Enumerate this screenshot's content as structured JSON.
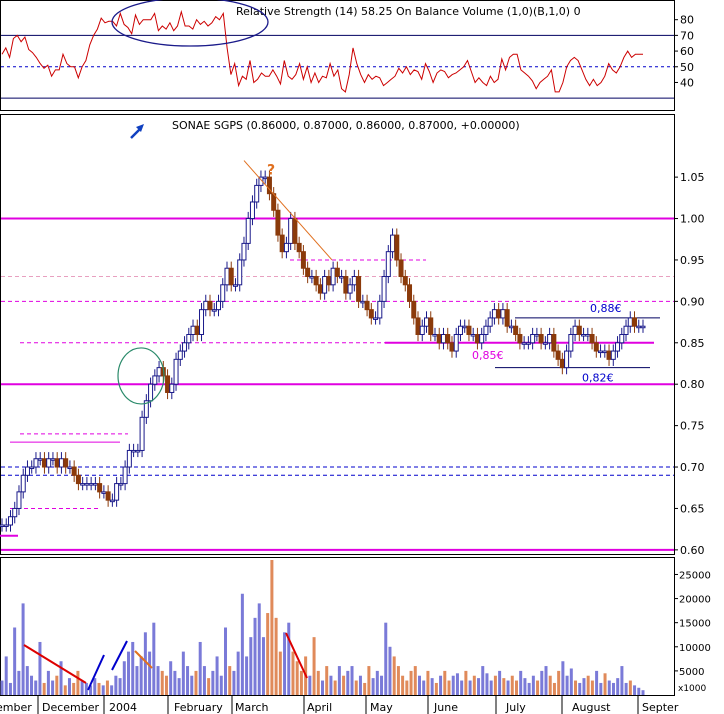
{
  "colors": {
    "rsi": "#cc0000",
    "bull": "#1a1a8a",
    "bear": "#8b3a0a",
    "vol_up": "#7a7ad8",
    "vol_down": "#e08a5a",
    "magenta": "#e000e0",
    "blue": "#0000cc",
    "green": "#2a8a6a",
    "orange": "#e07020",
    "arrow": "#1040c0",
    "frame": "#000060",
    "pink_dashed": "#e8a0c0"
  },
  "chart_data": [
    {
      "type": "line",
      "panel": "rsi",
      "title": "Relative Strength (14) 58.25  On Balance Volume (1,0)(B,1,0) 0",
      "ylim": [
        25,
        90
      ],
      "yticks": [
        40,
        50,
        60,
        70,
        80
      ],
      "reference_lines": [
        30,
        50,
        70
      ],
      "series": [
        {
          "values": [
            58,
            62,
            56,
            68,
            70,
            66,
            69,
            61,
            59,
            56,
            52,
            49,
            51,
            44,
            48,
            48,
            58,
            52,
            50,
            50,
            43,
            50,
            54,
            64,
            70,
            74,
            81,
            78,
            79,
            79,
            76,
            84,
            77,
            75,
            71,
            83,
            77,
            80,
            80,
            80,
            84,
            73,
            76,
            74,
            78,
            73,
            76,
            85,
            76,
            76,
            74,
            80,
            77,
            79,
            76,
            78,
            82,
            80,
            84,
            62,
            45,
            52,
            38,
            44,
            42,
            54,
            40,
            42,
            46,
            44,
            44,
            48,
            44,
            39,
            54,
            44,
            42,
            45,
            52,
            42,
            50,
            40,
            46,
            40,
            44,
            43,
            52,
            44,
            48,
            36,
            34,
            45,
            62,
            52,
            45,
            40,
            45,
            42,
            44,
            43,
            38,
            40,
            42,
            44,
            49,
            46,
            50,
            45,
            48,
            47,
            42,
            52,
            47,
            40,
            46,
            48,
            47,
            43,
            45,
            46,
            48,
            50,
            54,
            47,
            40,
            43,
            40,
            38,
            44,
            40,
            42,
            55,
            48,
            56,
            58,
            58,
            48,
            46,
            44,
            41,
            36,
            40,
            42,
            44,
            48,
            34,
            34,
            40,
            50,
            54,
            56,
            54,
            48,
            42,
            38,
            42,
            38,
            40,
            44,
            52,
            48,
            46,
            50,
            56,
            60,
            56,
            58,
            58,
            58
          ]
        }
      ]
    },
    {
      "type": "candlestick",
      "panel": "price",
      "title": "SONAE SGPS (0.86000, 0.87000, 0.86000, 0.87000, +0.00000)",
      "ylim": [
        0.595,
        1.125
      ],
      "yticks": [
        "0.60",
        "0.65",
        "0.70",
        "0.75",
        "0.80",
        "0.85",
        "0.90",
        "0.95",
        "1.00",
        "1.05"
      ],
      "closes": [
        0.63,
        0.63,
        0.64,
        0.65,
        0.67,
        0.69,
        0.7,
        0.7,
        0.71,
        0.71,
        0.7,
        0.71,
        0.71,
        0.7,
        0.71,
        0.7,
        0.7,
        0.69,
        0.68,
        0.68,
        0.68,
        0.68,
        0.68,
        0.67,
        0.67,
        0.66,
        0.66,
        0.68,
        0.68,
        0.7,
        0.72,
        0.72,
        0.72,
        0.76,
        0.78,
        0.8,
        0.81,
        0.82,
        0.81,
        0.79,
        0.8,
        0.83,
        0.84,
        0.85,
        0.86,
        0.87,
        0.86,
        0.89,
        0.9,
        0.89,
        0.89,
        0.9,
        0.92,
        0.94,
        0.92,
        0.92,
        0.95,
        0.97,
        1.0,
        1.02,
        1.04,
        1.05,
        1.05,
        1.03,
        1.01,
        0.98,
        0.96,
        0.97,
        1.0,
        0.97,
        0.96,
        0.94,
        0.93,
        0.93,
        0.92,
        0.91,
        0.93,
        0.92,
        0.94,
        0.93,
        0.93,
        0.91,
        0.92,
        0.93,
        0.9,
        0.9,
        0.89,
        0.88,
        0.88,
        0.9,
        0.93,
        0.96,
        0.98,
        0.95,
        0.93,
        0.92,
        0.9,
        0.88,
        0.86,
        0.87,
        0.88,
        0.86,
        0.86,
        0.85,
        0.86,
        0.85,
        0.84,
        0.86,
        0.87,
        0.87,
        0.86,
        0.86,
        0.85,
        0.86,
        0.87,
        0.88,
        0.89,
        0.88,
        0.89,
        0.87,
        0.87,
        0.86,
        0.85,
        0.85,
        0.85,
        0.86,
        0.86,
        0.85,
        0.85,
        0.86,
        0.84,
        0.83,
        0.82,
        0.84,
        0.86,
        0.87,
        0.86,
        0.86,
        0.86,
        0.85,
        0.84,
        0.84,
        0.84,
        0.83,
        0.84,
        0.85,
        0.86,
        0.87,
        0.88,
        0.87,
        0.87,
        0.87
      ],
      "reference_lines": [
        {
          "value": 1.0,
          "style": "solid",
          "color": "magenta"
        },
        {
          "value": 0.8,
          "style": "solid",
          "color": "magenta"
        },
        {
          "value": 0.6,
          "style": "solid",
          "color": "magenta"
        },
        {
          "value": 0.9,
          "style": "dashed",
          "color": "magenta"
        },
        {
          "value": 0.93,
          "style": "dashed",
          "color": "pink_dashed"
        },
        {
          "value": 0.7,
          "style": "dashed",
          "color": "blue"
        },
        {
          "value": 0.69,
          "style": "dashed",
          "color": "blue"
        }
      ],
      "annotations": [
        {
          "text": "0,88€",
          "price": 0.88,
          "color": "blue"
        },
        {
          "text": "0,85€",
          "price": 0.85,
          "color": "magenta"
        },
        {
          "text": "0,82€",
          "price": 0.82,
          "color": "blue"
        },
        {
          "text": "?",
          "color": "orange"
        }
      ]
    },
    {
      "type": "bar",
      "panel": "volume",
      "ylim": [
        0,
        28000
      ],
      "yticks": [
        5000,
        10000,
        15000,
        20000,
        25000
      ],
      "unit_label": "x1000",
      "values": [
        3000,
        8000,
        2500,
        14000,
        5000,
        19000,
        6000,
        4000,
        3000,
        11000,
        2500,
        5000,
        3000,
        4000,
        7000,
        2000,
        3500,
        2500,
        5000,
        3000,
        2500,
        2000,
        3500,
        2500,
        2000,
        3000,
        2000,
        4000,
        3500,
        7000,
        9000,
        11000,
        6000,
        8000,
        13000,
        9000,
        15000,
        6000,
        5000,
        4000,
        7000,
        5000,
        3500,
        9000,
        6000,
        4000,
        5000,
        11000,
        6000,
        3500,
        5000,
        8000,
        4000,
        14000,
        6000,
        5000,
        9000,
        21000,
        8000,
        12000,
        16000,
        19000,
        12000,
        17000,
        28000,
        16000,
        9000,
        13000,
        15000,
        9000,
        7000,
        5000,
        8000,
        4000,
        12000,
        5000,
        3000,
        6000,
        4000,
        3000,
        6000,
        4000,
        5000,
        6000,
        3000,
        4000,
        2500,
        6000,
        3500,
        5000,
        4000,
        15000,
        10000,
        8000,
        6000,
        4000,
        3000,
        5000,
        6000,
        4000,
        3000,
        5000,
        3500,
        2500,
        4000,
        5000,
        3000,
        4000,
        4500,
        3000,
        5000,
        3000,
        4000,
        3500,
        6000,
        4500,
        3000,
        4000,
        5000,
        3500,
        3000,
        4000,
        3000,
        5000,
        3500,
        2500,
        4000,
        3000,
        5000,
        6000,
        4000,
        2500,
        5000,
        7000,
        4000,
        5500,
        3000,
        2500,
        3500,
        4000,
        3000,
        5000,
        2500,
        4500,
        3000,
        2500,
        3500,
        6000,
        2500,
        3000,
        2000,
        1500,
        1000
      ],
      "month_labels": [
        "ember",
        "December",
        "2004",
        "February",
        "March",
        "April",
        "May",
        "June",
        "July",
        "August",
        "Septer"
      ]
    }
  ]
}
